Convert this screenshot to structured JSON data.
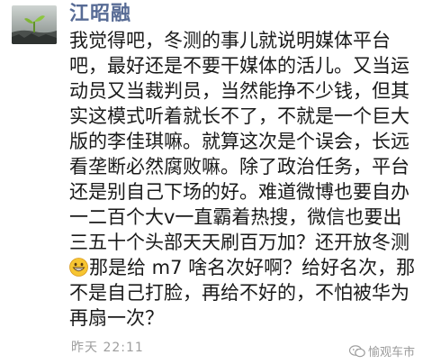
{
  "post": {
    "author": "江昭融",
    "lines": [
      "我觉得吧，冬测的事儿就说明媒体平台",
      "吧，最好还是不要干媒体的活儿。又当运",
      "动员又当裁判员，当然能挣不少钱，但其",
      "实这模式听着就长不了，不就是一个巨大",
      "版的李佳琪嘛。就算这次是个误会，长远",
      "看垄断必然腐败嘛。除了政治任务，平台",
      "还是别自己下场的好。难道微博也要自办",
      "一二百个大v一直霸着热搜，微信也要出",
      "三五十个头部天天刷百万加？还开放冬测",
      "那是给 m7 啥名次好啊？给好名次，那",
      "不是自己打脸，再给不好的，不怕被华为",
      "再扇一次？"
    ],
    "emoji_icon": "grinning-face-emoji",
    "timestamp": "昨天  22:11"
  },
  "watermark": {
    "icon": "wechat-official-account-icon",
    "text": "愉观车市"
  }
}
